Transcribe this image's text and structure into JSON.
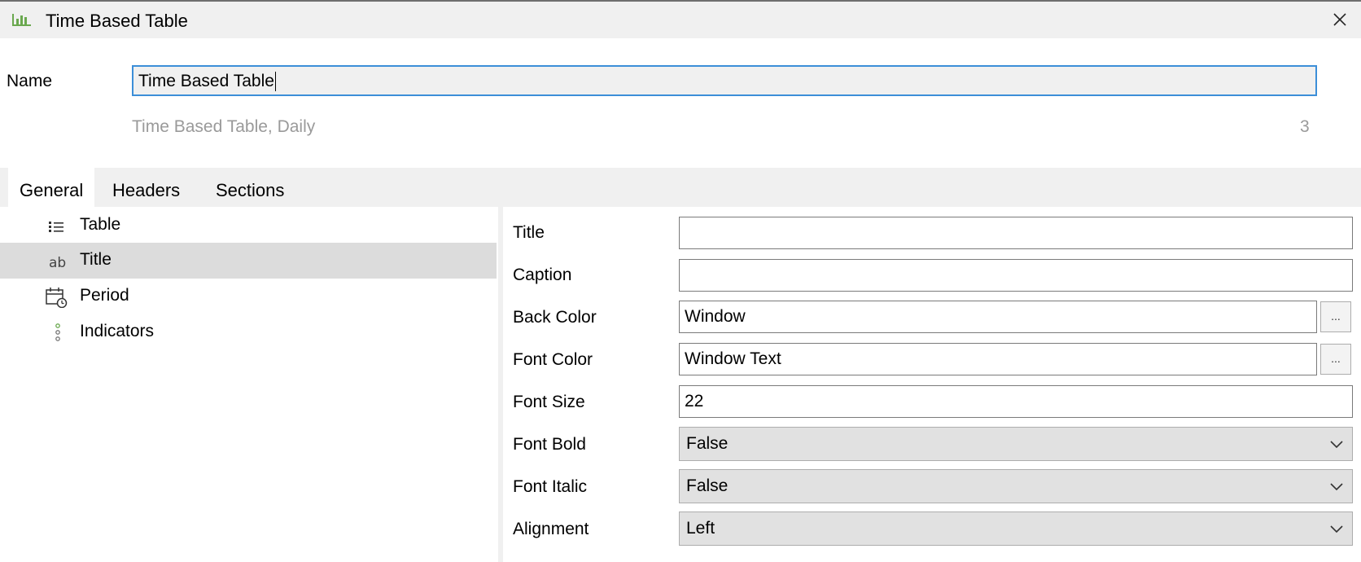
{
  "window": {
    "title": "Time Based Table",
    "title_icon": "bar-chart-icon",
    "close_icon": "close-icon"
  },
  "name_field": {
    "label": "Name",
    "value": "Time Based Table"
  },
  "subtitle": "Time Based Table, Daily",
  "count": "3",
  "tabs": [
    {
      "label": "General",
      "active": true
    },
    {
      "label": "Headers",
      "active": false
    },
    {
      "label": "Sections",
      "active": false
    }
  ],
  "tree": [
    {
      "label": "Table",
      "icon": "list-icon",
      "selected": false
    },
    {
      "label": "Title",
      "icon": "text-ab-icon",
      "selected": true
    },
    {
      "label": "Period",
      "icon": "calendar-clock-icon",
      "selected": false
    },
    {
      "label": "Indicators",
      "icon": "vertical-dots-icon",
      "selected": false
    }
  ],
  "properties": {
    "title": {
      "label": "Title",
      "value": ""
    },
    "caption": {
      "label": "Caption",
      "value": ""
    },
    "back_color": {
      "label": "Back Color",
      "value": "Window",
      "button": "..."
    },
    "font_color": {
      "label": "Font Color",
      "value": "Window Text",
      "button": "..."
    },
    "font_size": {
      "label": "Font Size",
      "value": "22"
    },
    "font_bold": {
      "label": "Font Bold",
      "value": "False"
    },
    "font_italic": {
      "label": "Font Italic",
      "value": "False"
    },
    "alignment": {
      "label": "Alignment",
      "value": "Left"
    }
  },
  "colors": {
    "accent": "#3c8ed8",
    "icon_green": "#6aa84f",
    "selected_row": "#dcdcdc"
  }
}
